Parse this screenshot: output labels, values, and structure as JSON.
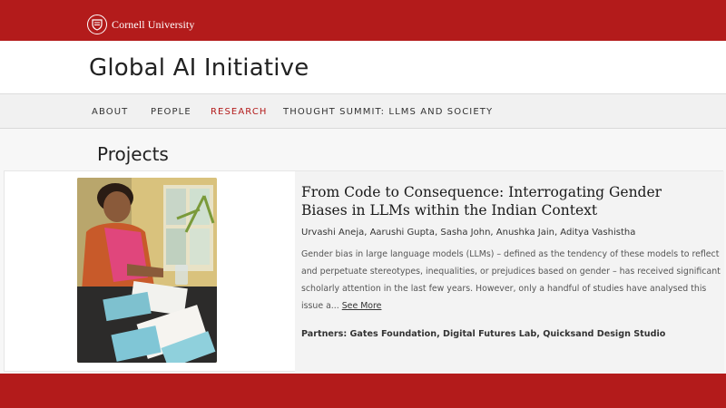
{
  "brand": {
    "name": "Cornell University"
  },
  "site": {
    "title": "Global AI Initiative"
  },
  "nav": {
    "items": [
      {
        "label": "ABOUT"
      },
      {
        "label": "PEOPLE"
      },
      {
        "label": "RESEARCH",
        "active": true
      },
      {
        "label": "THOUGHT SUMMIT: LLMS AND SOCIETY"
      }
    ]
  },
  "page": {
    "heading": "Projects"
  },
  "project": {
    "title": "From Code to Consequence: Interrogating Gender Biases in LLMs within the Indian Context",
    "authors": "Urvashi Aneja, Aarushi Gupta, Sasha John, Anushka Jain, Aditya Vashistha",
    "abstract": "Gender bias in large language models (LLMs) – defined as the tendency of these models to reflect and perpetuate stereotypes, inequalities, or prejudices based on gender – has received significant scholarly attention in the last few years. However, only a handful of studies have analysed this issue a...",
    "see_more": "See More",
    "partners": "Partners: Gates Foundation, Digital Futures Lab, Quicksand Design Studio"
  },
  "colors": {
    "brand_red": "#b31b1b",
    "active_nav": "#b31b1b",
    "page_bg": "#f7f7f7"
  }
}
